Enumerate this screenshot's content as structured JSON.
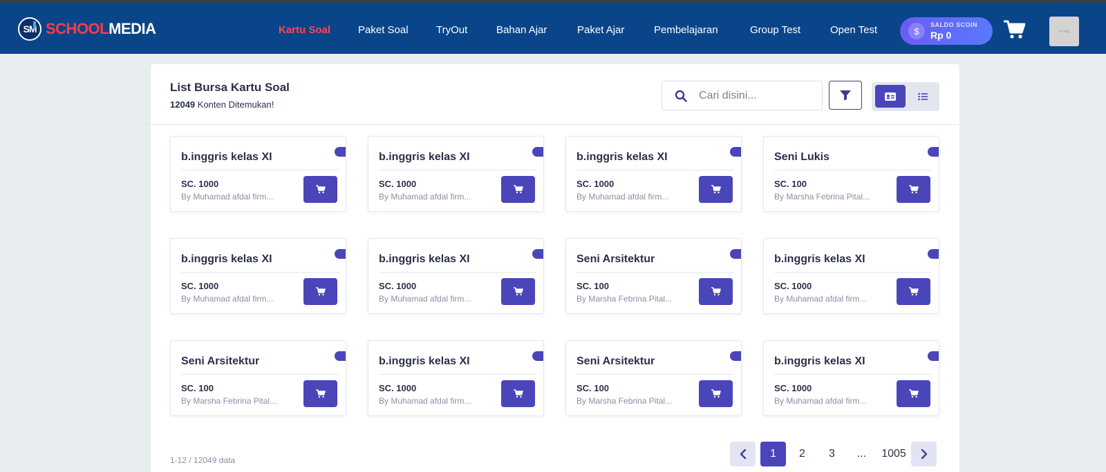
{
  "brand": {
    "mark": "SM",
    "name_part1": "SCHOOL",
    "name_part2": "MEDIA"
  },
  "nav": {
    "items": [
      {
        "label": "Kartu Soal",
        "active": true
      },
      {
        "label": "Paket Soal"
      },
      {
        "label": "TryOut"
      },
      {
        "label": "Bahan Ajar"
      },
      {
        "label": "Paket Ajar"
      },
      {
        "label": "Pembelajaran"
      },
      {
        "label": "Group Test"
      },
      {
        "label": "Open Test"
      }
    ],
    "saldo": {
      "coin_symbol": "$",
      "label": "SALDO SCOIN",
      "value": "Rp 0"
    },
    "avatar_text": "no img"
  },
  "panel": {
    "title": "List Bursa Kartu Soal",
    "count": "12049",
    "count_suffix": " Konten Ditemukan!",
    "search_placeholder": "Cari disini..."
  },
  "cards": [
    {
      "title": "b.inggris kelas XI",
      "price": "SC. 1000",
      "author": "By Muhamad afdal firm..."
    },
    {
      "title": "b.inggris kelas XI",
      "price": "SC. 1000",
      "author": "By Muhamad afdal firm..."
    },
    {
      "title": "b.inggris kelas XI",
      "price": "SC. 1000",
      "author": "By Muhamad afdal firm..."
    },
    {
      "title": "Seni Lukis",
      "price": "SC. 100",
      "author": "By Marsha Febrina Pital..."
    },
    {
      "title": "b.inggris kelas XI",
      "price": "SC. 1000",
      "author": "By Muhamad afdal firm..."
    },
    {
      "title": "b.inggris kelas XI",
      "price": "SC. 1000",
      "author": "By Muhamad afdal firm..."
    },
    {
      "title": "Seni Arsitektur",
      "price": "SC. 100",
      "author": "By Marsha Febrina Pital..."
    },
    {
      "title": "b.inggris kelas XI",
      "price": "SC. 1000",
      "author": "By Muhamad afdal firm..."
    },
    {
      "title": "Seni Arsitektur",
      "price": "SC. 100",
      "author": "By Marsha Febrina Pital..."
    },
    {
      "title": "b.inggris kelas XI",
      "price": "SC. 1000",
      "author": "By Muhamad afdal firm..."
    },
    {
      "title": "Seni Arsitektur",
      "price": "SC. 100",
      "author": "By Marsha Febrina Pital..."
    },
    {
      "title": "b.inggris kelas XI",
      "price": "SC. 1000",
      "author": "By Muhamad afdal firm..."
    }
  ],
  "pagination": {
    "range": "1-12 / 12049 data",
    "pages": [
      "1",
      "2",
      "3",
      "...",
      "1005"
    ],
    "current": "1"
  },
  "colors": {
    "navbar": "#0a4589",
    "accent": "#4b45ba",
    "active_nav": "#ff4757",
    "brand_red": "#ff3b4a"
  }
}
